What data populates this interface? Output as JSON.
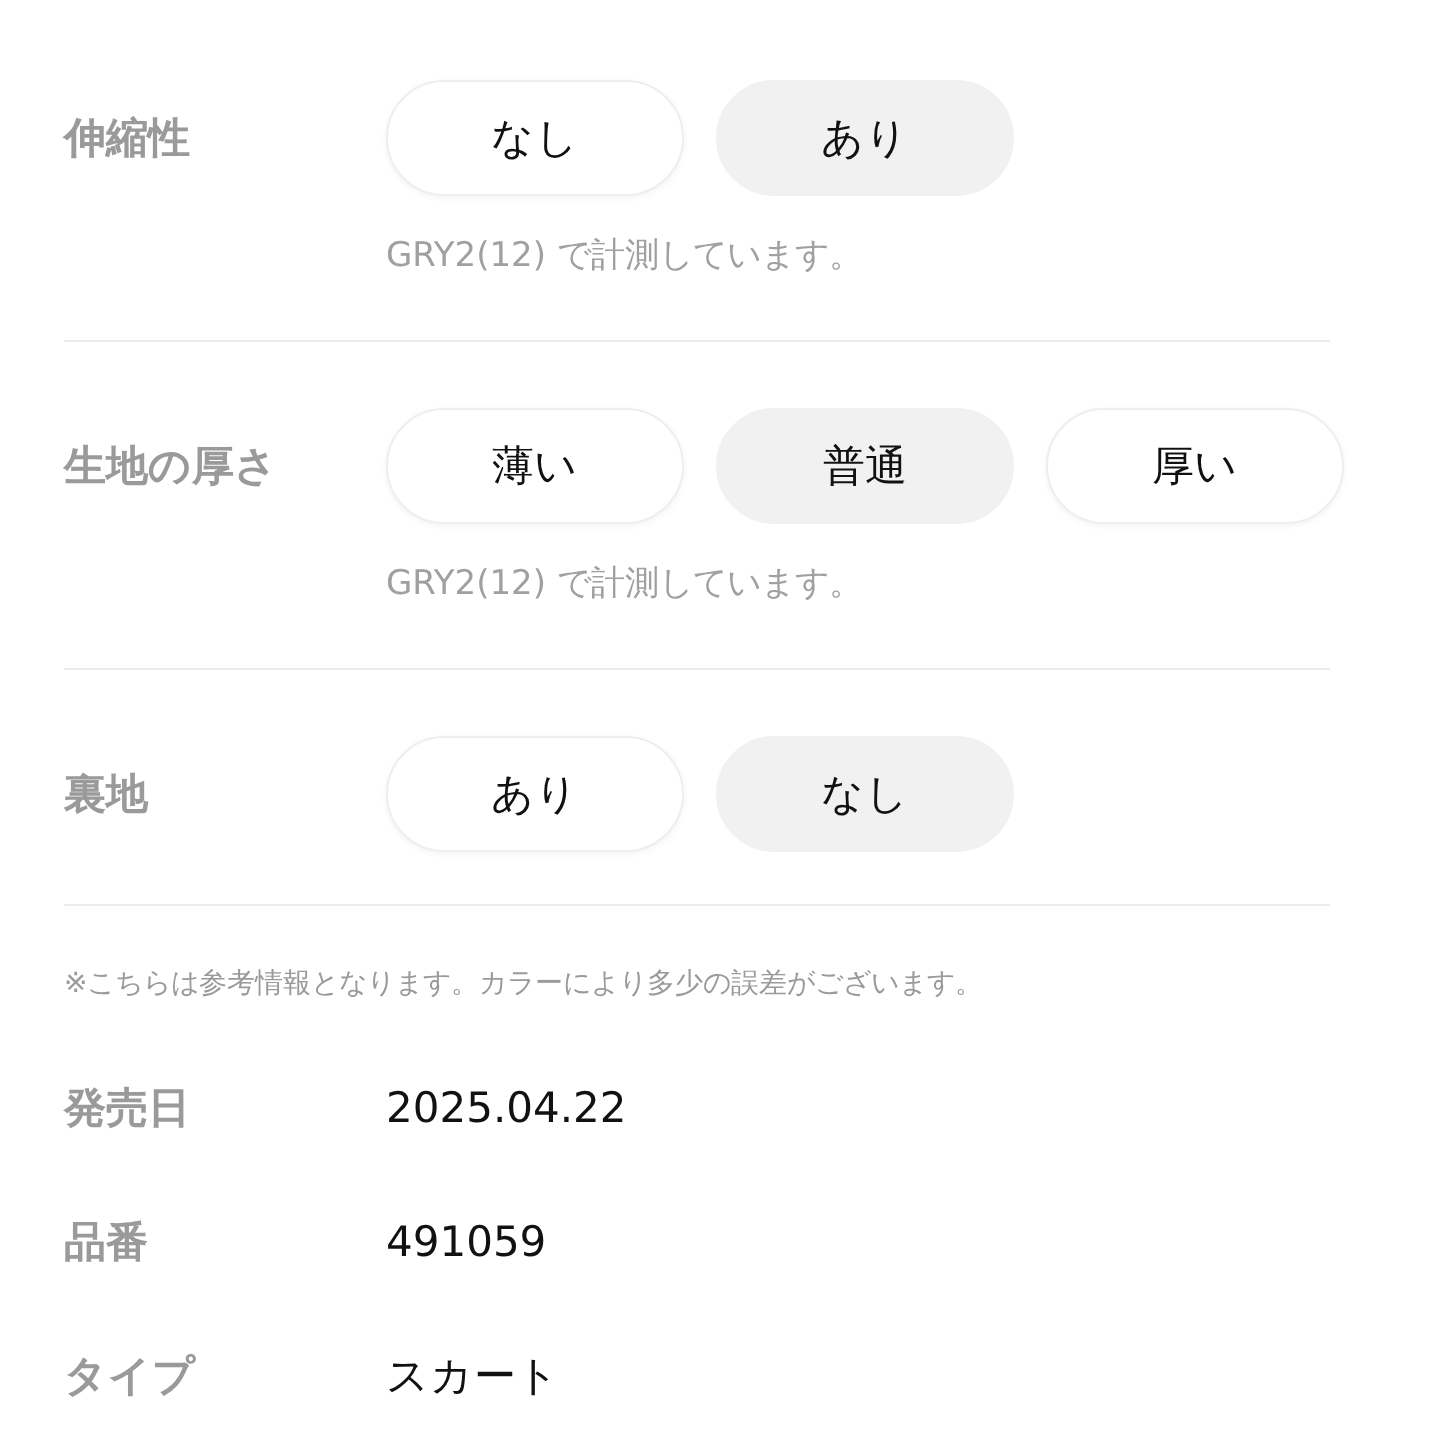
{
  "attributes": [
    {
      "label": "伸縮性",
      "options": [
        {
          "label": "なし",
          "selected": false
        },
        {
          "label": "あり",
          "selected": true
        }
      ],
      "note": "GRY2(12) で計測しています。"
    },
    {
      "label": "生地の厚さ",
      "options": [
        {
          "label": "薄い",
          "selected": false
        },
        {
          "label": "普通",
          "selected": true
        },
        {
          "label": "厚い",
          "selected": false
        }
      ],
      "note": "GRY2(12) で計測しています。"
    },
    {
      "label": "裏地",
      "options": [
        {
          "label": "あり",
          "selected": false
        },
        {
          "label": "なし",
          "selected": true
        }
      ]
    }
  ],
  "disclaimer": "※こちらは参考情報となります。カラーにより多少の誤差がございます。",
  "details": [
    {
      "label": "発売日",
      "value": "2025.04.22"
    },
    {
      "label": "品番",
      "value": "491059"
    },
    {
      "label": "タイプ",
      "value": "スカート"
    }
  ]
}
